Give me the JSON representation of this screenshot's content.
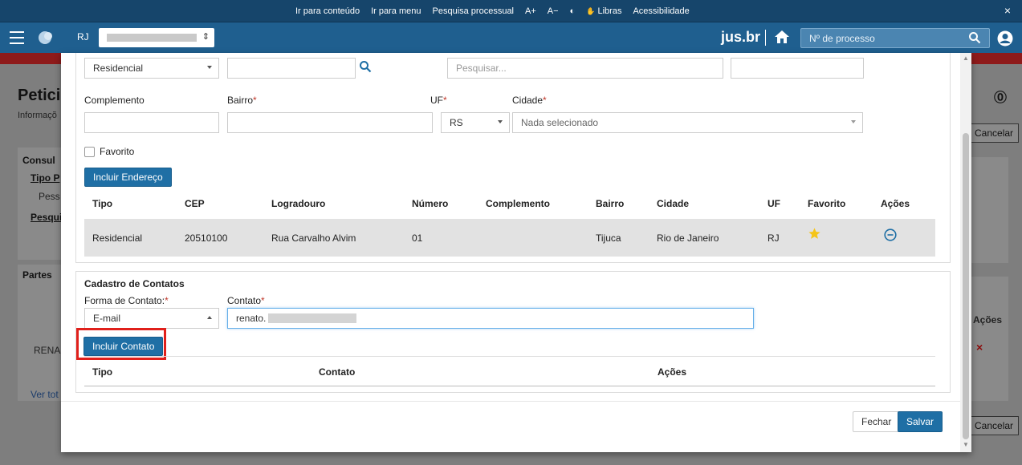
{
  "topbar": {
    "links": [
      "Ir para conteúdo",
      "Ir para menu",
      "Pesquisa processual",
      "A+",
      "A−",
      "◐",
      "Libras",
      "Acessibilidade"
    ],
    "close": "×"
  },
  "header": {
    "region": "RJ",
    "brand": "jus.br",
    "search_placeholder": "Nº de processo"
  },
  "background": {
    "title": "Petici",
    "subtitle": "Informaçõ",
    "consulta_label": "Consul",
    "tipo_label": "Tipo P",
    "tipo_value": "Pess",
    "pesquisa_label": "Pesqui",
    "partes_label": "Partes",
    "row_name": "RENA",
    "ver_todos": "Ver tot",
    "acoes": "Ações",
    "cancelar_top": "Cancelar",
    "cancelar_bottom": "Cancelar",
    "remove": "×"
  },
  "address": {
    "tipo_select": "Residencial",
    "logradouro_placeholder": "Pesquisar...",
    "complemento_label": "Complemento",
    "bairro_label": "Bairro",
    "uf_label": "UF",
    "cidade_label": "Cidade",
    "req": "*",
    "uf_value": "RS",
    "cidade_value": "Nada selecionado",
    "favorito_label": "Favorito",
    "incluir_button": "Incluir Endereço",
    "table": {
      "headers": [
        "Tipo",
        "CEP",
        "Logradouro",
        "Número",
        "Complemento",
        "Bairro",
        "Cidade",
        "UF",
        "Favorito",
        "Ações"
      ],
      "rows": [
        {
          "tipo": "Residencial",
          "cep": "20510100",
          "logradouro": "Rua Carvalho Alvim",
          "numero": "01",
          "complemento": "",
          "bairro": "Tijuca",
          "cidade": "Rio de Janeiro",
          "uf": "RJ"
        }
      ]
    }
  },
  "contacts": {
    "title": "Cadastro de Contatos",
    "forma_label": "Forma de Contato:",
    "contato_label": "Contato",
    "req": "*",
    "forma_value": "E-mail",
    "contato_value": "renato.",
    "incluir_button": "Incluir Contato",
    "table_headers": [
      "Tipo",
      "Contato",
      "Ações"
    ]
  },
  "footer": {
    "close": "Fechar",
    "save": "Salvar"
  },
  "colors": {
    "header": "#1f5f8f",
    "primary": "#1f6fa5",
    "highlight": "#e0201b",
    "star": "#f5c518"
  }
}
